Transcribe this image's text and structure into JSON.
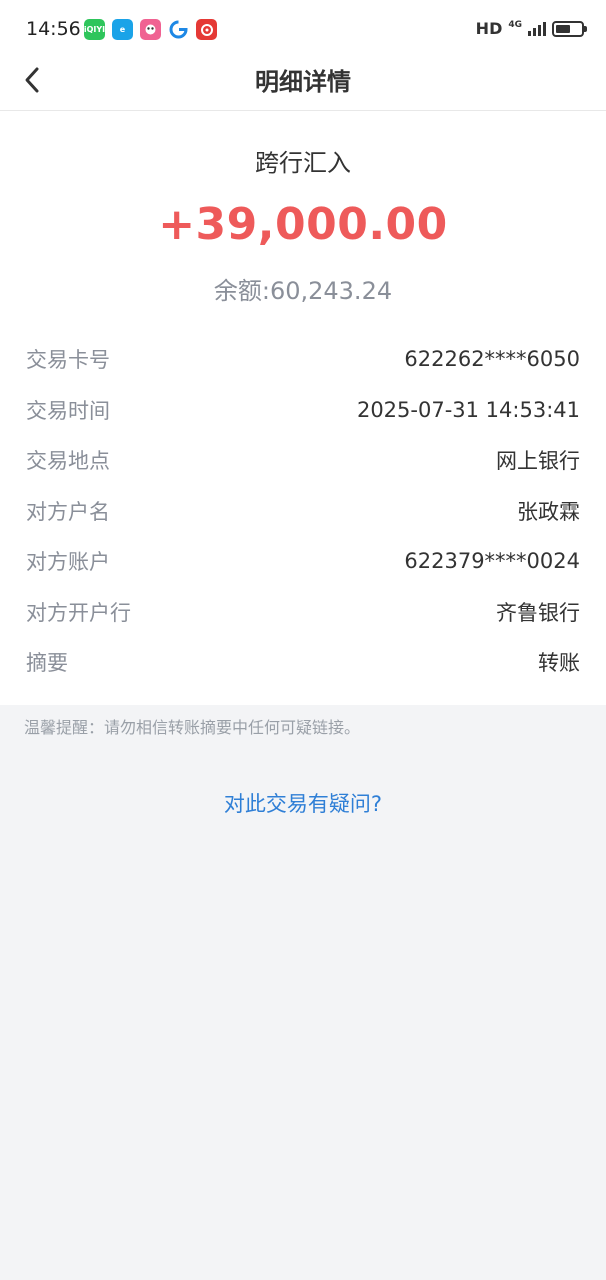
{
  "status_bar": {
    "time": "14:56",
    "apps": [
      {
        "icon": "iqiyi-icon",
        "label": "iQIYI",
        "color": "#2ec55b"
      },
      {
        "icon": "edge-app-icon",
        "label": "e",
        "color": "#1aa3e8"
      },
      {
        "icon": "mascot-app-icon",
        "label": "",
        "color": "#f06292"
      },
      {
        "icon": "browser-icon",
        "label": "",
        "color": "#1e88e5"
      },
      {
        "icon": "netease-music-icon",
        "label": "",
        "color": "#e53935"
      }
    ],
    "hd": "HD",
    "network": "4G"
  },
  "nav": {
    "title": "明细详情"
  },
  "transaction": {
    "type": "跨行汇入",
    "amount": "+39,000.00",
    "balance": "余额:60,243.24",
    "amount_color": "#ee5a5a"
  },
  "details": [
    {
      "label": "交易卡号",
      "value": "622262****6050"
    },
    {
      "label": "交易时间",
      "value": "2025-07-31 14:53:41"
    },
    {
      "label": "交易地点",
      "value": "网上银行"
    },
    {
      "label": "对方户名",
      "value": "张政霖"
    },
    {
      "label": "对方账户",
      "value": "622379****0024"
    },
    {
      "label": "对方开户行",
      "value": "齐鲁银行"
    },
    {
      "label": "摘要",
      "value": "转账"
    }
  ],
  "tip": "温馨提醒：请勿相信转账摘要中任何可疑链接。",
  "question_link": "对此交易有疑问?",
  "colors": {
    "link": "#2f7fd6",
    "background": "#f3f4f6"
  }
}
